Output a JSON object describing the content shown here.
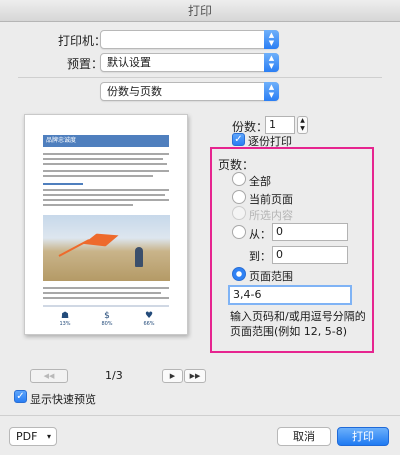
{
  "window": {
    "title": "打印"
  },
  "printer": {
    "label": "打印机：",
    "value": ""
  },
  "presets": {
    "label": "预置：",
    "value": "默认设置"
  },
  "panel": {
    "value": "份数与页数"
  },
  "preview": {
    "heading": "品牌忠诚度",
    "stats": [
      "13%",
      "80%",
      "66%"
    ]
  },
  "pager": {
    "first": "◀◀",
    "prev": "◀",
    "page": "1/3",
    "next": "▶",
    "last": "▶▶"
  },
  "copies": {
    "label": "份数：",
    "value": "1",
    "collate_label": "逐份打印",
    "collate_checked": true
  },
  "pages": {
    "label": "页数：",
    "all": "全部",
    "current": "当前页面",
    "selection": "所选内容",
    "from_label": "从：",
    "from_value": "0",
    "to_label": "到：",
    "to_value": "0",
    "range_label": "页面范围",
    "range_value": "3,4-6",
    "hint": "输入页码和/或用逗号分隔的页面范围(例如 12, 5-8)"
  },
  "quick_preview": {
    "label": "显示快速预览",
    "checked": true
  },
  "footer": {
    "pdf": "PDF",
    "cancel": "取消",
    "print": "打印"
  },
  "colors": {
    "accent": "#2a7ef4",
    "highlight": "#e6248f"
  }
}
